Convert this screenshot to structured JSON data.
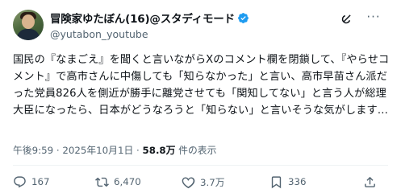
{
  "author": {
    "display_name": "冒険家ゆたぼん(16)@スタディモード",
    "handle": "@yutabon_youtube"
  },
  "tweet": {
    "text": "国民の『なまごえ』を聞くと言いながらXのコメント欄を閉鎖して、『やらせコメント』で高市さんに中傷しても「知らなかった」と言い、高市早苗さん派だった党員826人を側近が勝手に離党させても「関知してない」と言う人が総理大臣になったら、日本がどうなろうと「知らない」と言いそうな気がします…"
  },
  "meta": {
    "time": "午後9:59",
    "sep1": "·",
    "date": "2025年10月1日",
    "sep2": "·",
    "views_count": "58.8万",
    "views_label": " 件の表示"
  },
  "actions": {
    "replies": "167",
    "retweets": "6,470",
    "likes": "3.7万",
    "bookmarks": "336"
  },
  "colors": {
    "verified": "#1d9bf0",
    "muted": "#536471",
    "text": "#0f1419"
  }
}
